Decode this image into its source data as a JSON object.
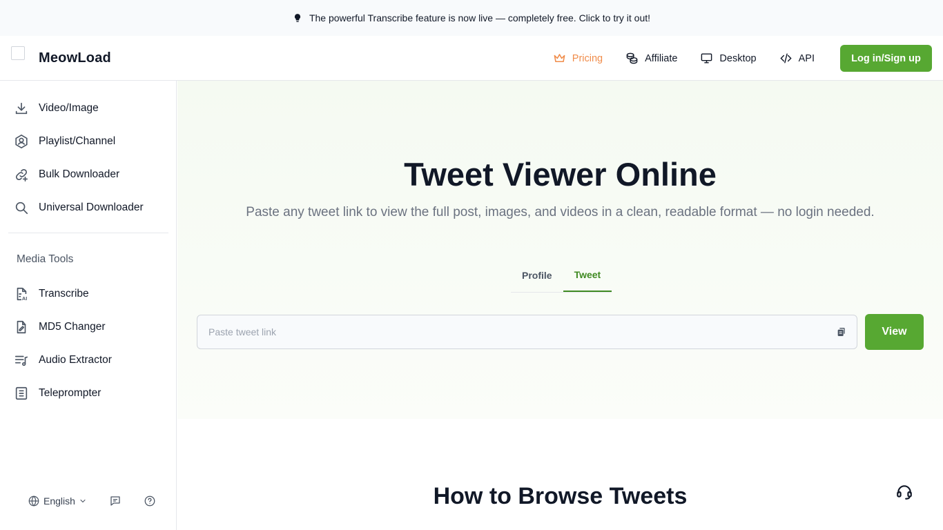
{
  "announcement": {
    "text": "The powerful Transcribe feature is now live — completely free. Click to try it out!",
    "icon": "lightbulb-icon"
  },
  "header": {
    "brand": "MeowLoad",
    "nav": [
      {
        "label": "Pricing",
        "icon": "crown-icon"
      },
      {
        "label": "Affiliate",
        "icon": "coins-icon"
      },
      {
        "label": "Desktop",
        "icon": "monitor-icon"
      },
      {
        "label": "API",
        "icon": "code-icon"
      }
    ],
    "login_label": "Log in/Sign up"
  },
  "sidebar": {
    "items": [
      {
        "label": "Video/Image",
        "icon": "download-icon"
      },
      {
        "label": "Playlist/Channel",
        "icon": "user-hexagon-icon"
      },
      {
        "label": "Bulk Downloader",
        "icon": "link-plus-icon"
      },
      {
        "label": "Universal Downloader",
        "icon": "search-icon"
      }
    ],
    "section_title": "Media Tools",
    "tools": [
      {
        "label": "Transcribe",
        "icon": "file-ai-icon"
      },
      {
        "label": "MD5 Changer",
        "icon": "file-edit-icon"
      },
      {
        "label": "Audio Extractor",
        "icon": "music-list-icon"
      },
      {
        "label": "Teleprompter",
        "icon": "document-lines-icon"
      }
    ],
    "footer": {
      "language": "English"
    }
  },
  "main": {
    "title": "Tweet Viewer Online",
    "subtitle": "Paste any tweet link to view the full post, images, and videos in a clean, readable format — no login needed.",
    "tabs": [
      {
        "label": "Profile"
      },
      {
        "label": "Tweet",
        "active": true
      }
    ],
    "input": {
      "placeholder": "Paste tweet link",
      "value": ""
    },
    "view_label": "View",
    "how_title": "How to Browse Tweets"
  },
  "colors": {
    "accent": "#57a832",
    "tab_active": "#3f8a22",
    "pricing": "#f08c4a"
  }
}
